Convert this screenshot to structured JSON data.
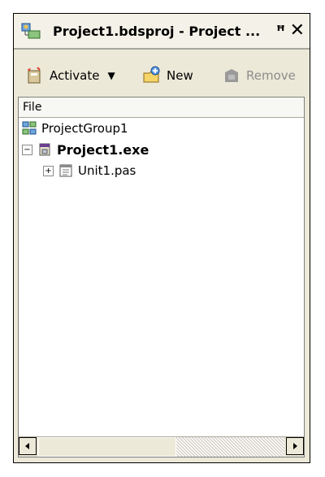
{
  "window": {
    "title": "Project1.bdsproj - Project ...",
    "pin_glyph": "ꟸ",
    "close_glyph": "✕"
  },
  "toolbar": {
    "activate_label": "Activate",
    "activate_dropdown": "▼",
    "new_label": "New",
    "remove_label": "Remove"
  },
  "tree": {
    "header": "File",
    "items": [
      {
        "label": "ProjectGroup1",
        "bold": false,
        "icon": "project-group-icon"
      },
      {
        "label": "Project1.exe",
        "bold": true,
        "icon": "project-exe-icon",
        "expander": "−"
      },
      {
        "label": "Unit1.pas",
        "bold": false,
        "icon": "unit-file-icon",
        "expander": "+"
      }
    ]
  }
}
